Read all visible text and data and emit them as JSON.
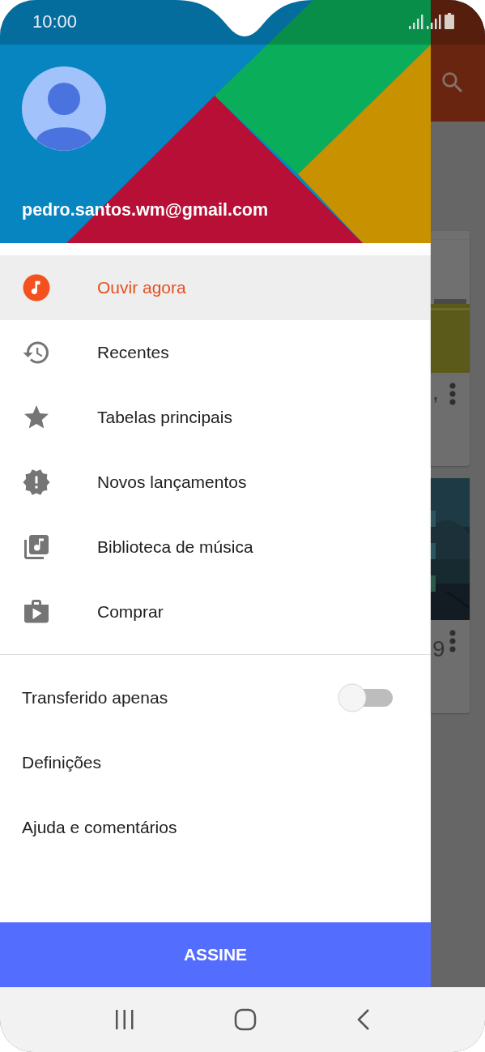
{
  "status_bar": {
    "time": "10:00"
  },
  "account": {
    "email": "pedro.santos.wm@gmail.com"
  },
  "nav_items": [
    {
      "label": "Ouvir agora",
      "kind": "listen",
      "selected": true
    },
    {
      "label": "Recentes",
      "kind": "history",
      "selected": false
    },
    {
      "label": "Tabelas principais",
      "kind": "star",
      "selected": false
    },
    {
      "label": "Novos lançamentos",
      "kind": "new",
      "selected": false
    },
    {
      "label": "Biblioteca de música",
      "kind": "library",
      "selected": false
    },
    {
      "label": "Comprar",
      "kind": "shop",
      "selected": false
    }
  ],
  "settings_items": [
    {
      "label": "Transferido apenas",
      "kind": "toggle",
      "on": false
    },
    {
      "label": "Definições",
      "kind": "link"
    },
    {
      "label": "Ajuda e comentários",
      "kind": "link"
    }
  ],
  "subscribe_button": "ASSINE",
  "background_cards": [
    {
      "kind": "light",
      "title": ","
    },
    {
      "kind": "dark",
      "title": "9"
    }
  ]
}
